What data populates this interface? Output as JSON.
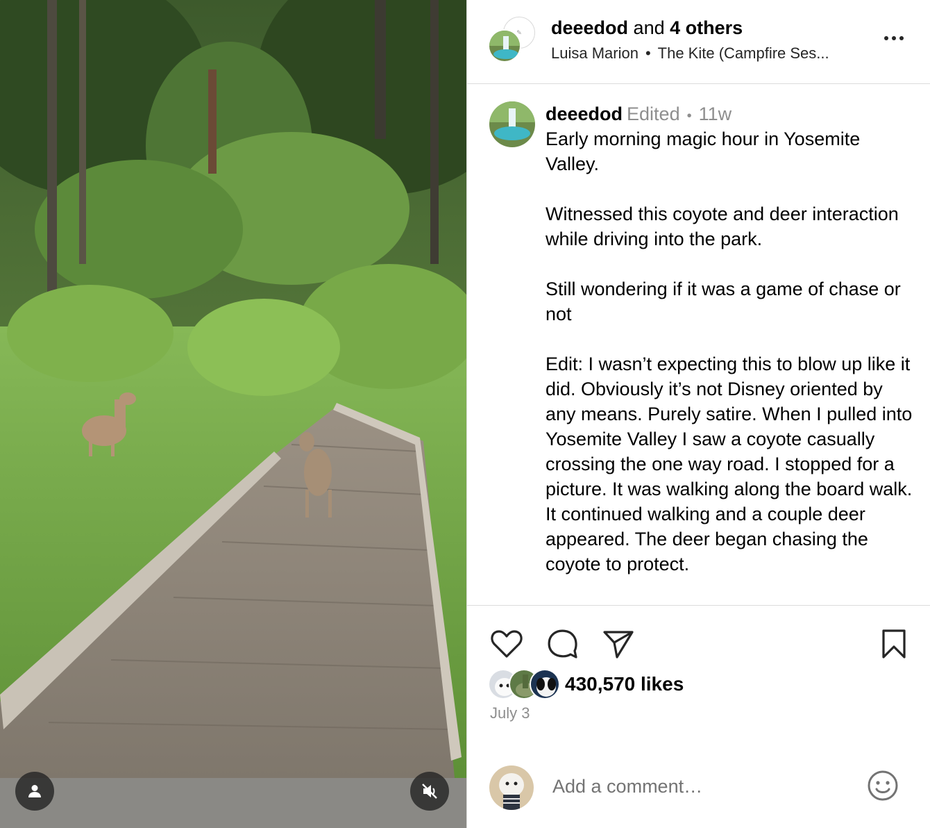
{
  "header": {
    "username": "deeedod",
    "and_text": "and",
    "others": "4 others",
    "artist": "Luisa Marion",
    "separator": "•",
    "song": "The Kite (Campfire Ses..."
  },
  "caption": {
    "username": "deeedod",
    "edited": "Edited",
    "separator": "•",
    "time_ago": "11w",
    "paragraphs": [
      "Early morning magic hour in Yosemite Valley.",
      "Witnessed this coyote and deer interaction while driving into the park.",
      "Still wondering if it was a game of chase or not",
      "Edit: I wasn’t expecting this to blow up like it did. Obviously it’s not Disney oriented by any means. Purely satire. When I pulled into Yosemite Valley I saw a coyote casually crossing the one way road. I stopped for a picture. It was walking along the board walk. It continued walking and a couple deer appeared. The deer began chasing the coyote to protect."
    ]
  },
  "stats": {
    "likes": "430,570 likes",
    "date": "July 3"
  },
  "comment": {
    "placeholder": "Add a comment…"
  },
  "icons": {
    "tag": "user-tag-icon",
    "mute": "muted-speaker-icon",
    "more": "more-options-icon",
    "like": "heart-icon",
    "comment": "comment-bubble-icon",
    "share": "paper-plane-icon",
    "save": "bookmark-icon",
    "emoji": "smiley-icon"
  },
  "colors": {
    "muted_text": "#8e8e8e",
    "divider": "#dbdbdb",
    "overlay_button": "#262626"
  }
}
